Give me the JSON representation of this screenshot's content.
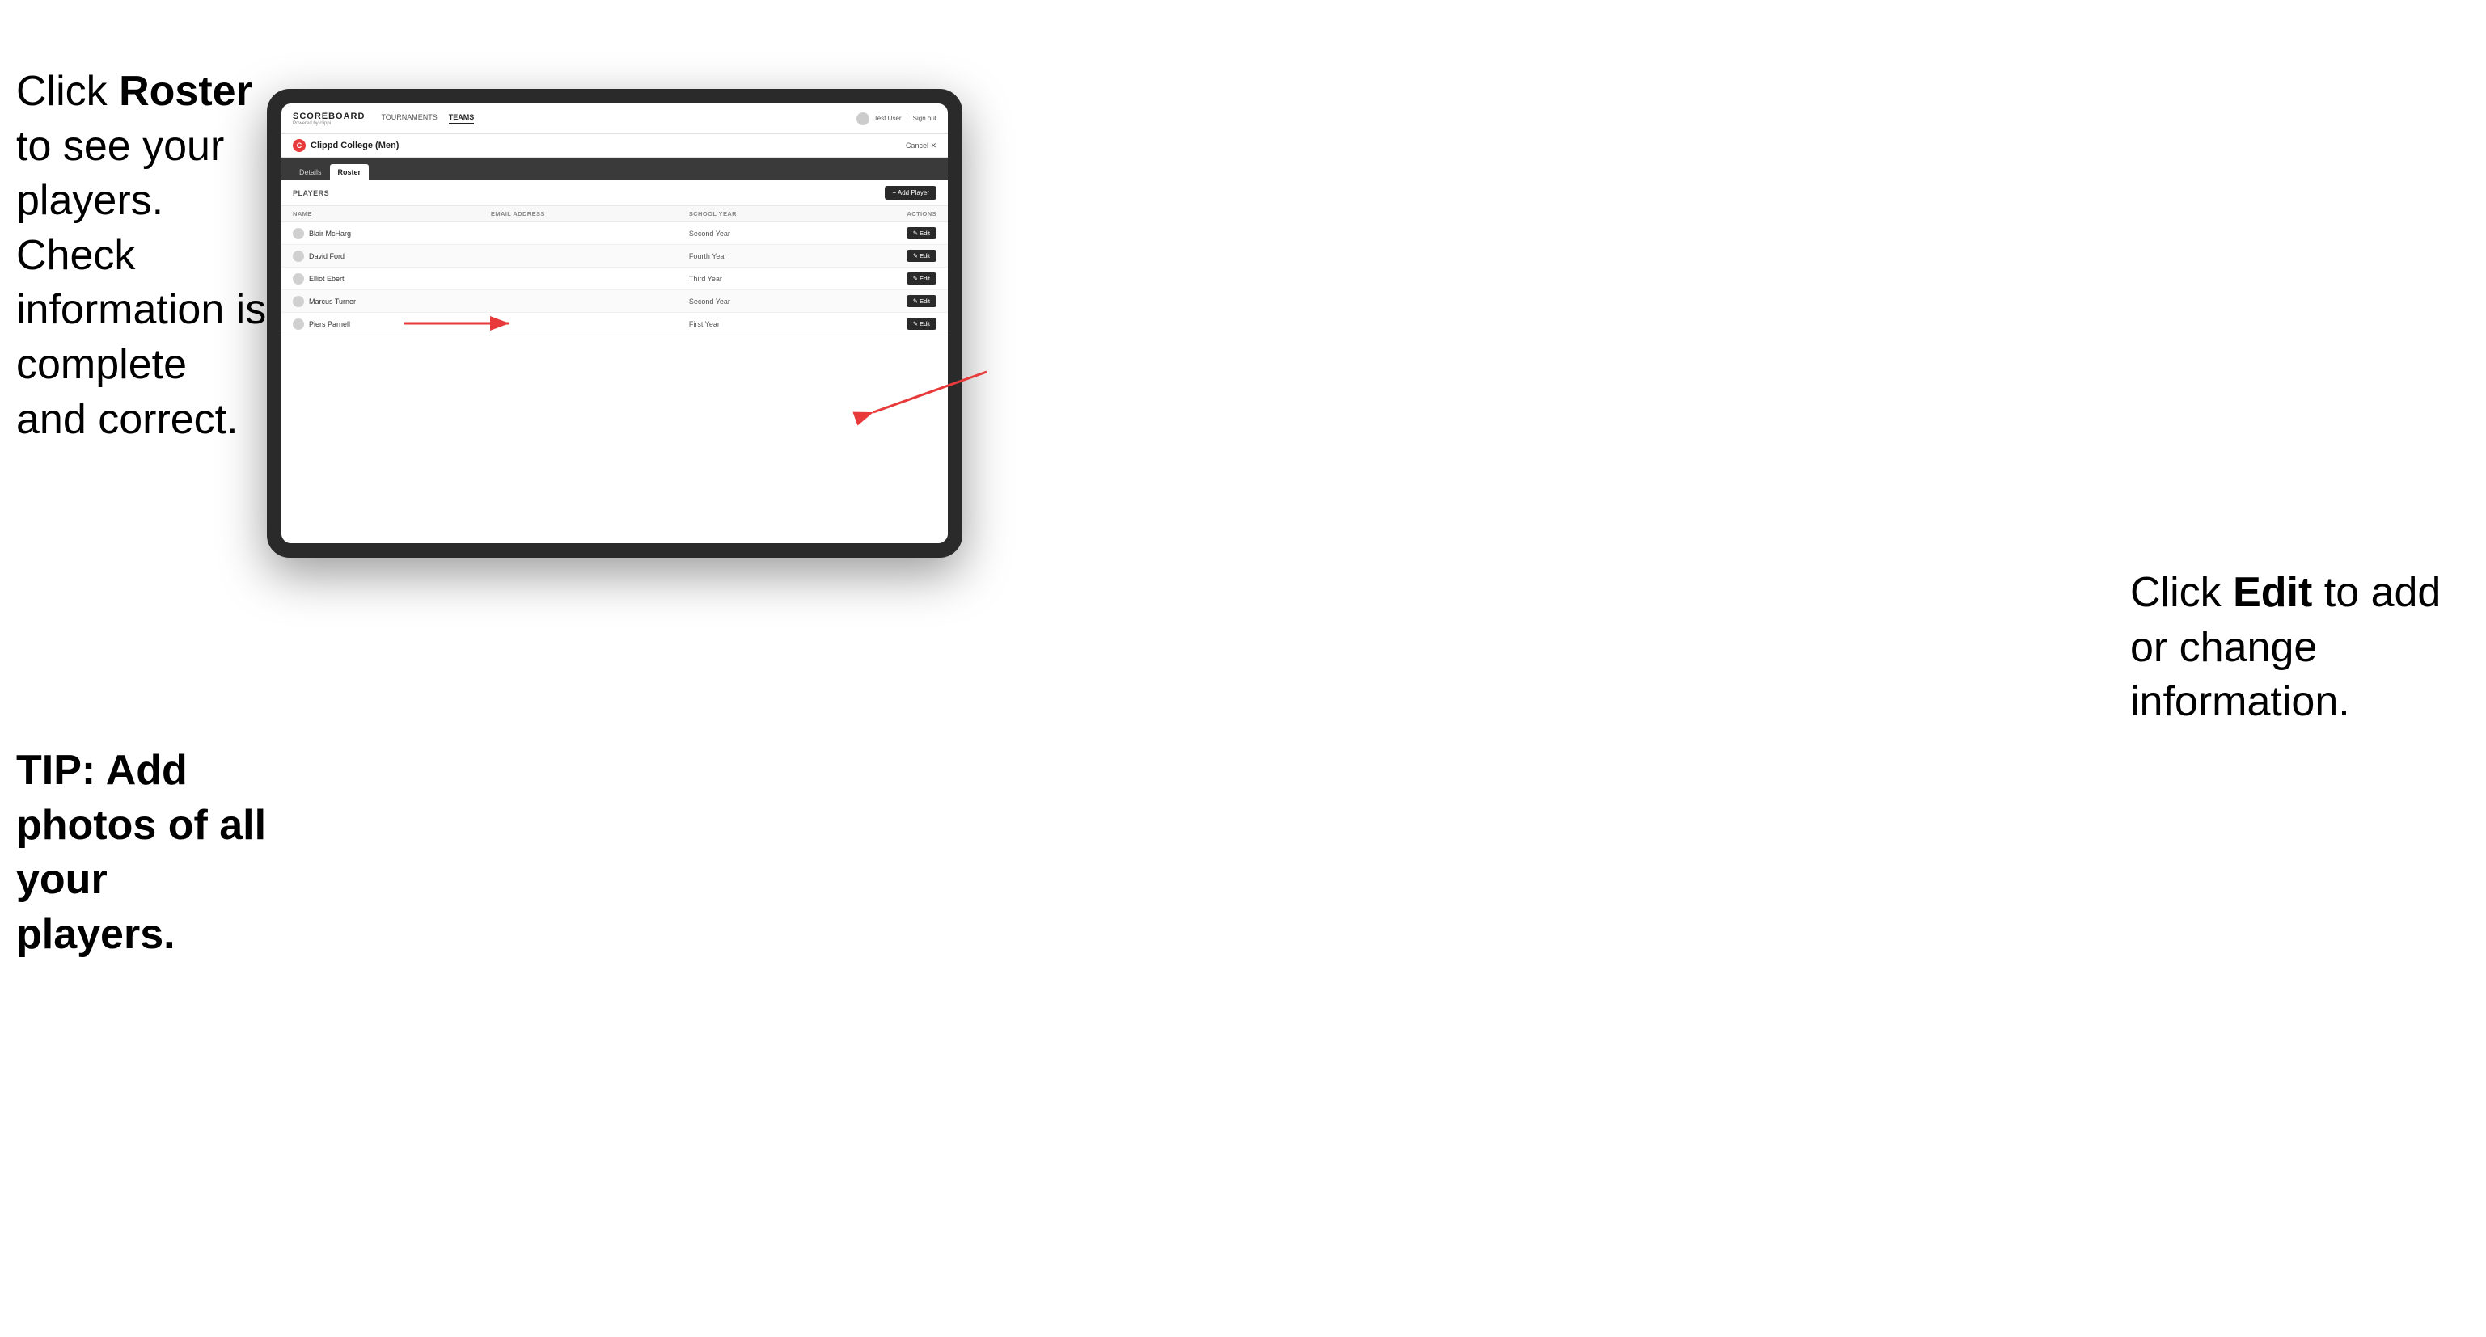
{
  "annotations": {
    "left_title": "Click ",
    "left_bold1": "Roster",
    "left_text": " to see your players. Check information is complete and correct.",
    "tip_label": "TIP: Add photos of all your players.",
    "right_text": "Click ",
    "right_bold": "Edit",
    "right_text2": " to add or change information."
  },
  "header": {
    "logo": "SCOREBOARD",
    "logo_sub": "Powered by clippi",
    "nav": [
      "TOURNAMENTS",
      "TEAMS"
    ],
    "active_nav": "TEAMS",
    "user": "Test User",
    "sign_out": "Sign out"
  },
  "team": {
    "logo_letter": "C",
    "name": "Clippd College (Men)",
    "cancel_label": "Cancel ✕"
  },
  "tabs": [
    {
      "label": "Details",
      "active": false
    },
    {
      "label": "Roster",
      "active": true
    }
  ],
  "players_section": {
    "label": "PLAYERS",
    "add_button": "+ Add Player"
  },
  "table": {
    "columns": [
      "NAME",
      "EMAIL ADDRESS",
      "SCHOOL YEAR",
      "ACTIONS"
    ],
    "rows": [
      {
        "name": "Blair McHarg",
        "email": "",
        "year": "Second Year"
      },
      {
        "name": "David Ford",
        "email": "",
        "year": "Fourth Year"
      },
      {
        "name": "Elliot Ebert",
        "email": "",
        "year": "Third Year"
      },
      {
        "name": "Marcus Turner",
        "email": "",
        "year": "Second Year"
      },
      {
        "name": "Piers Parnell",
        "email": "",
        "year": "First Year"
      }
    ],
    "edit_label": "✎ Edit"
  }
}
